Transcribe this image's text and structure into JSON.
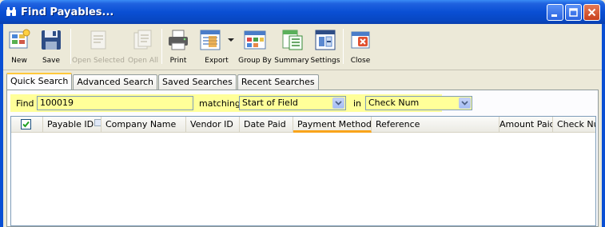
{
  "window": {
    "title": "Find Payables...",
    "controls": [
      "minimize",
      "maximize",
      "close"
    ]
  },
  "toolbar": {
    "items": [
      {
        "label": "New",
        "icon": "new-record-icon",
        "enabled": true
      },
      {
        "label": "Save",
        "icon": "save-disk-icon",
        "enabled": true
      },
      {
        "label": "Open Selected",
        "icon": "open-selected-icon",
        "enabled": false
      },
      {
        "label": "Open All",
        "icon": "open-all-icon",
        "enabled": false
      },
      {
        "label": "Print",
        "icon": "printer-icon",
        "enabled": true
      },
      {
        "label": "Export",
        "icon": "export-icon",
        "enabled": true
      },
      {
        "label": "Group By",
        "icon": "group-by-icon",
        "enabled": true
      },
      {
        "label": "Summary",
        "icon": "summary-icon",
        "enabled": true
      },
      {
        "label": "Settings",
        "icon": "settings-icon",
        "enabled": true
      },
      {
        "label": "Close",
        "icon": "close-window-icon",
        "enabled": true
      }
    ]
  },
  "tabs": [
    {
      "label": "Quick Search",
      "active": true
    },
    {
      "label": "Advanced Search",
      "active": false
    },
    {
      "label": "Saved Searches",
      "active": false
    },
    {
      "label": "Recent Searches",
      "active": false
    }
  ],
  "search": {
    "find_label": "Find",
    "find_value": "100019",
    "matching_label": "matching",
    "matching_value": "Start of Field",
    "in_label": "in",
    "in_value": "Check Num",
    "highlight_color": "#ffff99"
  },
  "grid": {
    "select_all_checked": true,
    "columns": [
      {
        "label": "Payable ID",
        "sortable_icon": true
      },
      {
        "label": "Company Name"
      },
      {
        "label": "Vendor ID"
      },
      {
        "label": "Date Paid"
      },
      {
        "label": "Payment Method",
        "sorted": true,
        "sortable_icon": true
      },
      {
        "label": "Reference"
      },
      {
        "label": "Amount Paid"
      },
      {
        "label": "Check Nu"
      }
    ],
    "rows": []
  },
  "colors": {
    "titlebar": "#0a4fd4",
    "sort_indicator": "#f9a41b",
    "active_tab_accent": "#ffc83c"
  }
}
